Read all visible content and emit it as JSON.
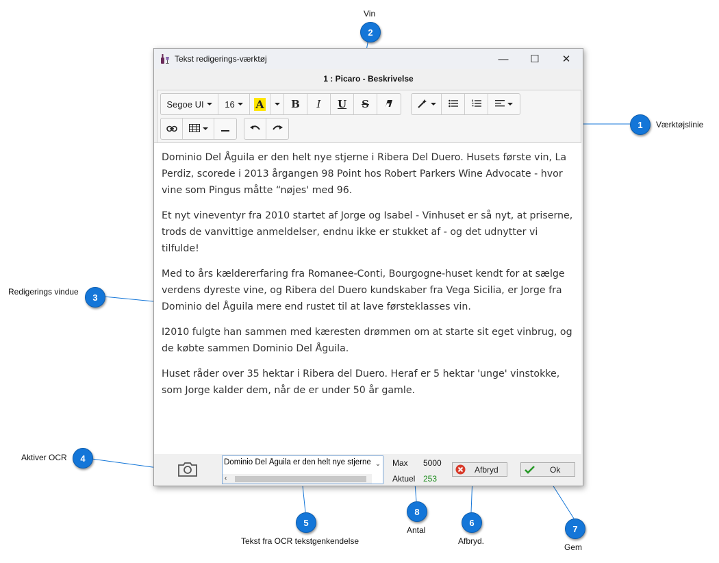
{
  "callouts": [
    {
      "num": "1",
      "label": "Værktøjslinie"
    },
    {
      "num": "2",
      "label": "Vin"
    },
    {
      "num": "3",
      "label": "Redigerings vindue"
    },
    {
      "num": "4",
      "label": "Aktiver OCR"
    },
    {
      "num": "5",
      "label": "Tekst fra OCR tekstgenkendelse"
    },
    {
      "num": "6",
      "label": "Afbryd."
    },
    {
      "num": "7",
      "label": "Gem"
    },
    {
      "num": "8",
      "label": "Antal"
    }
  ],
  "window": {
    "title": "Tekst redigerings-værktøj",
    "subtitle": "1 : Picaro - Beskrivelse",
    "controls": {
      "minimize": "—",
      "maximize": "☐",
      "close": "✕"
    }
  },
  "toolbar": {
    "font": "Segoe UI",
    "size": "16",
    "bold": "B",
    "italic": "I",
    "underline": "U",
    "strike": "S"
  },
  "editor": {
    "paragraphs": [
      "Dominio Del Åguila er den helt nye stjerne i Ribera Del Duero. Husets første vin, La Perdiz, scorede i 2013 årgangen 98 Point hos Robert Parkers Wine Advocate - hvor vine som Pingus måtte “nøjes' med 96.",
      "Et nyt vineventyr fra 2010 startet af Jorge og Isabel - Vinhuset er så nyt, at priserne, trods de vanvittige anmeldelser, endnu ikke er stukket af - og det udnytter vi tilfulde!",
      "Med to års kældererfaring fra Romanee-Conti, Bourgogne-huset kendt for at sælge verdens dyreste vine, og Ribera del Duero kundskaber fra Vega Sicilia, er Jorge fra Dominio del Åguila mere end rustet til at lave førsteklasses vin.",
      "I2010 fulgte han sammen med kæresten drømmen om at starte sit eget vinbrug, og de købte sammen Dominio Del Åguila.",
      "Huset råder over 35 hektar i Ribera del Duero. Heraf er 5 hektar 'unge' vinstokke, som Jorge kalder dem, når de er under 50 år gamle."
    ]
  },
  "bottom": {
    "ocr_text": "Dominio Del Åguila er den helt nye stjerne i Ribera Del Duero.",
    "max_label": "Max",
    "max_value": "5000",
    "current_label": "Aktuel",
    "current_value": "253",
    "cancel_label": "Afbryd",
    "ok_label": "Ok"
  },
  "colors": {
    "callout": "#1476d8",
    "current_value": "#1a8a1a",
    "cancel_icon": "#d83a2a",
    "ok_check": "#2a9a2a"
  }
}
